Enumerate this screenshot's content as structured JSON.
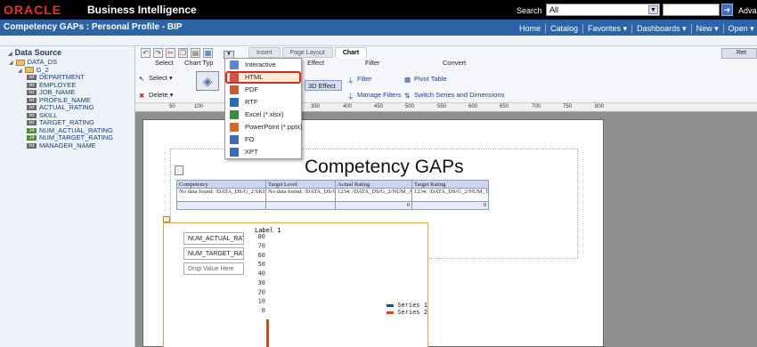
{
  "header": {
    "logo": "ORACLE",
    "product": "Business Intelligence",
    "search_label": "Search",
    "search_scope": "All",
    "advanced": "Advanced",
    "addl": "Ad"
  },
  "navbar": {
    "title": "Competency GAPs : Personal Profile - BIP",
    "links": [
      "Home",
      "Catalog",
      "Favorites ▾",
      "Dashboards ▾",
      "New ▾",
      "Open ▾"
    ]
  },
  "sidebar": {
    "title": "Data Source",
    "root": "DATA_DS",
    "group": "G_2",
    "fields": [
      {
        "label": "DEPARTMENT",
        "type": "txt"
      },
      {
        "label": "EMPLOYEE",
        "type": "txt"
      },
      {
        "label": "JOB_NAME",
        "type": "txt"
      },
      {
        "label": "PROFILE_NAME",
        "type": "txt"
      },
      {
        "label": "ACTUAL_RATING",
        "type": "txt"
      },
      {
        "label": "SKILL",
        "type": "txt"
      },
      {
        "label": "TARGET_RATING",
        "type": "txt"
      },
      {
        "label": "NUM_ACTUAL_RATING",
        "type": "num"
      },
      {
        "label": "NUM_TARGET_RATING",
        "type": "num"
      },
      {
        "label": "MANAGER_NAME",
        "type": "txt"
      }
    ]
  },
  "toolbar": {
    "tabs": [
      "Insert",
      "Page Layout",
      "Chart"
    ],
    "active_tab": "Chart",
    "return": "Ret",
    "groups": {
      "select": "Select",
      "chart_type": "Chart Typ",
      "effect": "Effect",
      "filter": "Filter",
      "convert": "Convert"
    },
    "select_btn": "Select ▾",
    "delete_btn": "Delete ▾",
    "effect_btn": "3D Effect",
    "filter_btn": "Filter",
    "manage_filters": "Manage Filters",
    "pivot_table": "Pivot Table",
    "switch_series": "Switch Series and Dimensions"
  },
  "ruler": [
    "50",
    "100",
    "300",
    "350",
    "400",
    "450",
    "500",
    "550",
    "600",
    "650",
    "700",
    "750",
    "800"
  ],
  "export_menu": {
    "items": [
      "Interactive",
      "HTML",
      "PDF",
      "RTF",
      "Excel (*.xlsx)",
      "PowerPoint (*.pptx)",
      "FO",
      "XPT"
    ],
    "highlighted": "HTML"
  },
  "report": {
    "title": "Competency GAPs",
    "headers": [
      "Competency",
      "Target Level",
      "Actual Rating",
      "Target Rating"
    ],
    "row": [
      "No data found: /DATA_DS/G_2/SKILL",
      "No data found: /DATA_DS/G_2/TARGET_R/",
      "1234: /DATA_DS/G_2/NUM_ACTU",
      "1234: /DATA_DS/G_2/NUM_TARG"
    ],
    "totals": [
      "",
      "",
      "0",
      "0"
    ]
  },
  "chart_drop_zones": [
    "NUM_ACTUAL_RAT",
    "NUM_TARGET_RAT",
    "Drop Value Here"
  ],
  "chart_data": {
    "type": "bar",
    "title": "Label 1",
    "y_ticks": [
      "80",
      "70",
      "60",
      "50",
      "40",
      "30",
      "20",
      "10",
      "0"
    ],
    "ylim": [
      0,
      80
    ],
    "series": [
      {
        "name": "Series 1",
        "color": "#1f4e79",
        "values": [
          0
        ]
      },
      {
        "name": "Series 2",
        "color": "#d9470f",
        "values": [
          0
        ]
      }
    ]
  }
}
